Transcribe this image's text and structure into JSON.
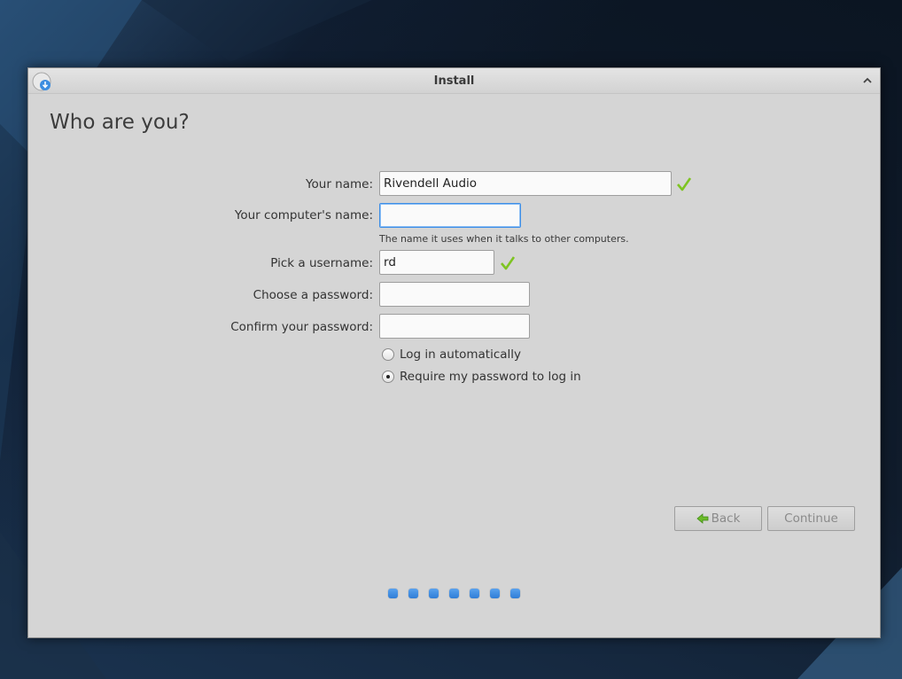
{
  "window": {
    "title": "Install"
  },
  "page": {
    "heading": "Who are you?"
  },
  "form": {
    "your_name": {
      "label": "Your name:",
      "value": "Rivendell Audio",
      "valid": true
    },
    "computer_name": {
      "label": "Your computer's name:",
      "value": "",
      "hint": "The name it uses when it talks to other computers."
    },
    "username": {
      "label": "Pick a username:",
      "value": "rd",
      "valid": true
    },
    "password": {
      "label": "Choose a password:",
      "value": ""
    },
    "confirm_password": {
      "label": "Confirm your password:",
      "value": ""
    },
    "login_options": [
      {
        "label": "Log in automatically",
        "selected": false
      },
      {
        "label": "Require my password to log in",
        "selected": true
      }
    ]
  },
  "buttons": {
    "back": "Back",
    "continue": "Continue"
  },
  "progress": {
    "steps": 7
  },
  "colors": {
    "accent": "#3d8ee6",
    "check": "#7ec422"
  }
}
